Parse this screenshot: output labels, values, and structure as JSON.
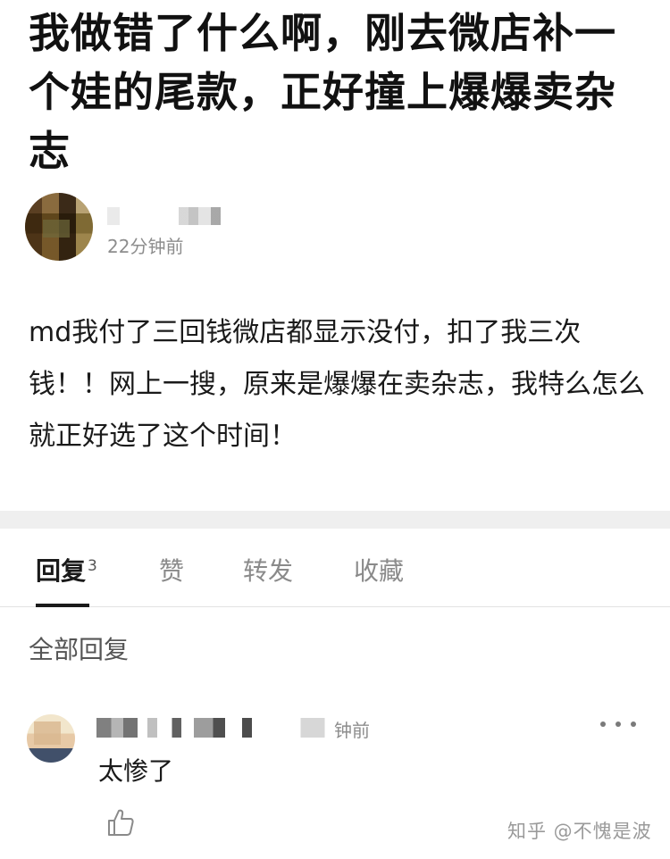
{
  "post": {
    "title": "我做错了什么啊，刚去微店补一个娃的尾款，正好撞上爆爆卖杂志",
    "time": "22分钟前",
    "body": "md我付了三回钱微店都显示没付，扣了我三次钱！！网上一搜，原来是爆爆在卖杂志，我特么怎么就正好选了这个时间！"
  },
  "tabs": [
    {
      "label": "回复",
      "count": "3",
      "active": true
    },
    {
      "label": "赞",
      "active": false
    },
    {
      "label": "转发",
      "active": false
    },
    {
      "label": "收藏",
      "active": false
    }
  ],
  "replies_section": {
    "title": "全部回复"
  },
  "replies": [
    {
      "time": "钟前",
      "content": "太惨了",
      "icons": [
        "more-icon",
        "thumbs-up-icon"
      ]
    }
  ],
  "watermark": "知乎 @不愧是波",
  "colors": {
    "text": "#1a1a1a",
    "muted": "#8d8d8d",
    "divider": "#efefef"
  }
}
